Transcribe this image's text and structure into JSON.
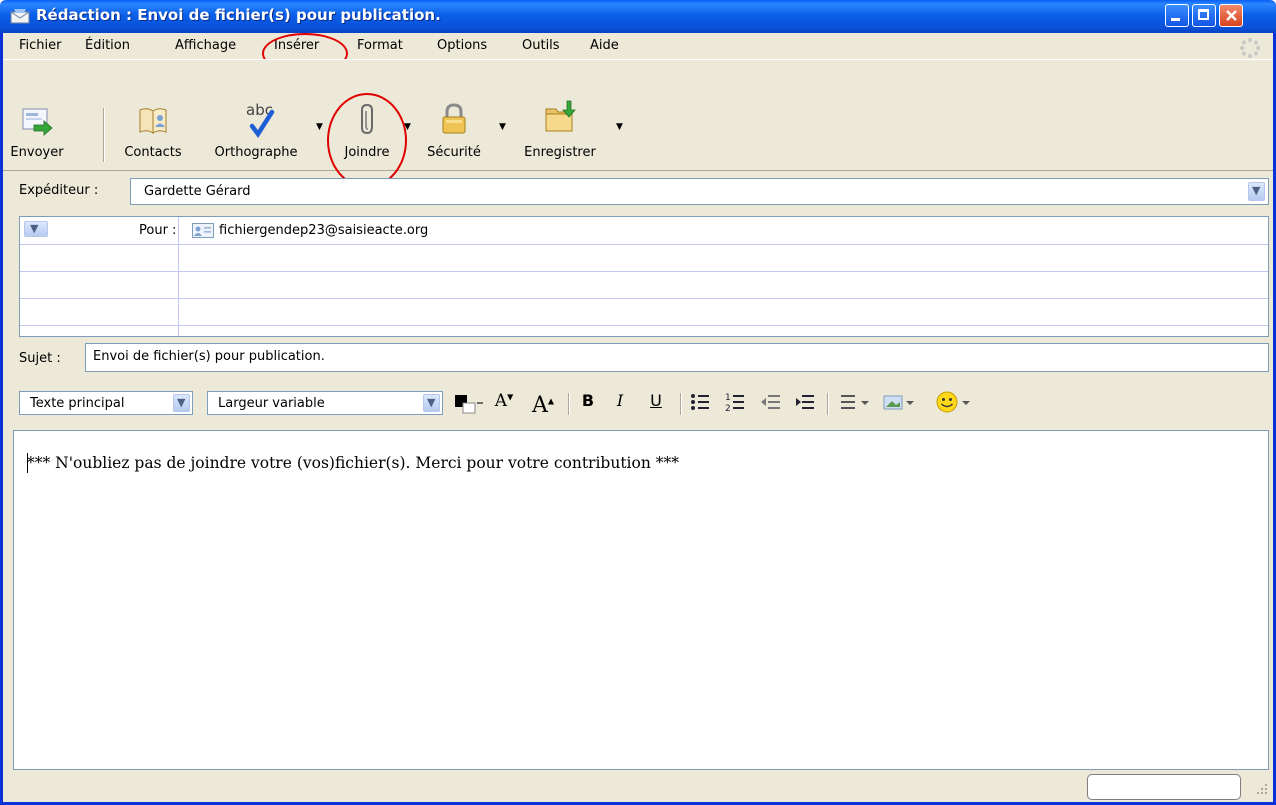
{
  "window": {
    "title": "Rédaction : Envoi de fichier(s) pour publication."
  },
  "menubar": {
    "items": [
      "Fichier",
      "Édition",
      "Affichage",
      "Insérer",
      "Format",
      "Options",
      "Outils",
      "Aide"
    ]
  },
  "toolbar": {
    "buttons": [
      {
        "label": "Envoyer",
        "icon": "send-icon"
      },
      {
        "label": "Contacts",
        "icon": "address-book-icon"
      },
      {
        "label": "Orthographe",
        "icon": "spellcheck-icon"
      },
      {
        "label": "Joindre",
        "icon": "paperclip-icon"
      },
      {
        "label": "Sécurité",
        "icon": "padlock-icon"
      },
      {
        "label": "Enregistrer",
        "icon": "save-folder-icon"
      }
    ]
  },
  "header": {
    "sender_label": "Expéditeur :",
    "sender_value": "Gardette Gérard",
    "to_label": "Pour :",
    "to_value": "fichiergendep23@saisieacte.org",
    "subject_label": "Sujet :",
    "subject_value": "Envoi de fichier(s) pour publication."
  },
  "format_toolbar": {
    "paragraph_style": "Texte principal",
    "font": "Largeur variable",
    "bold": "B",
    "italic": "I",
    "underline": "U"
  },
  "editor": {
    "body": "*** N'oubliez pas de joindre votre (vos)fichier(s). Merci pour votre contribution ***"
  },
  "colors": {
    "title_bar": "#0a5ff5",
    "window_bg": "#ece9d8",
    "annotation": "#e00000",
    "field_border": "#7f9db9"
  }
}
